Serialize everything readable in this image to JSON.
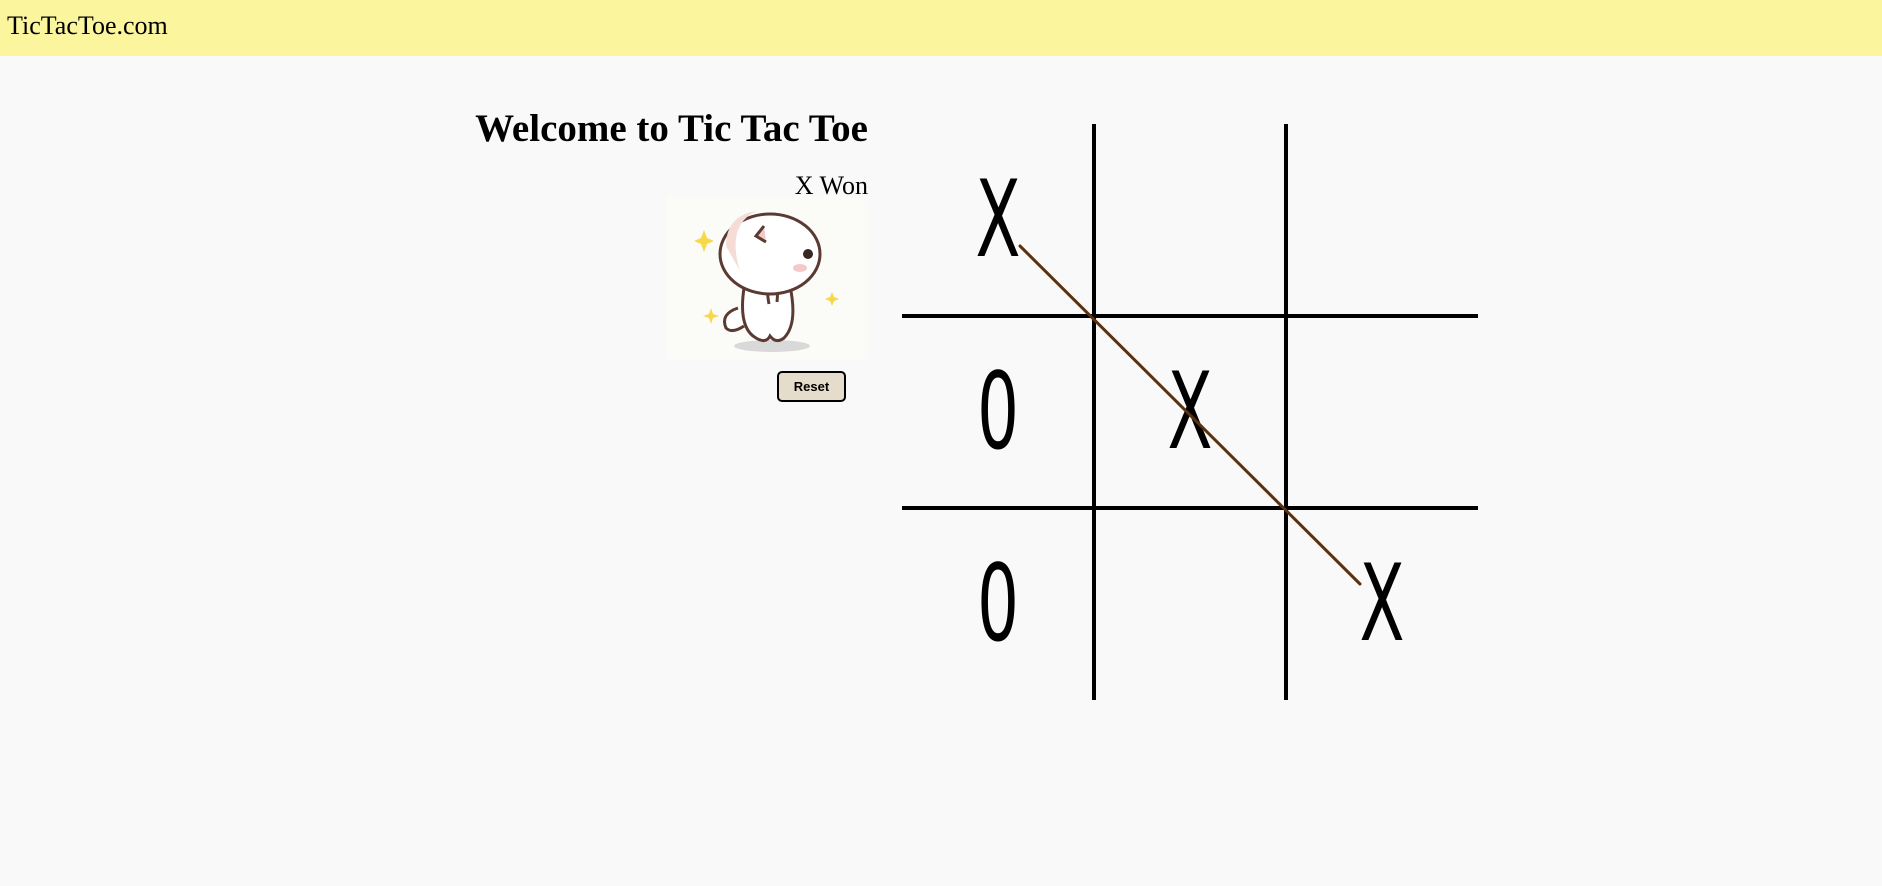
{
  "header": {
    "site_name": "TicTacToe.com"
  },
  "game": {
    "title": "Welcome to Tic Tac Toe",
    "status": "X Won",
    "reset_label": "Reset",
    "board": [
      [
        "X",
        "",
        ""
      ],
      [
        "0",
        "X",
        ""
      ],
      [
        "0",
        "",
        "X"
      ]
    ],
    "winning_line": "main-diagonal"
  },
  "colors": {
    "header_bg": "#fbf59e",
    "win_line": "#5a3210",
    "reset_bg": "#e6dccb"
  }
}
